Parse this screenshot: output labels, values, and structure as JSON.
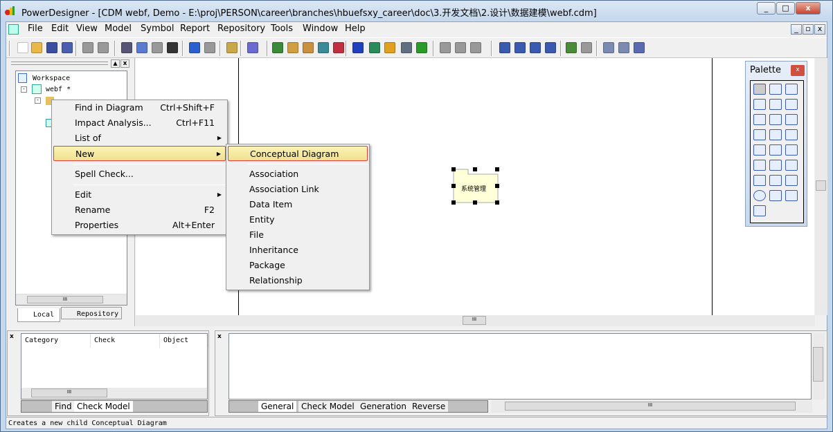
{
  "window": {
    "title": "PowerDesigner - [CDM webf, Demo - E:\\proj\\PERSON\\career\\branches\\hbuefsxy_career\\doc\\3.开发文档\\2.设计\\数据建模\\webf.cdm]",
    "buttons": [
      "_",
      "□",
      "x"
    ],
    "mdi_buttons": [
      "_",
      "▫",
      "x"
    ]
  },
  "menubar": [
    "File",
    "Edit",
    "View",
    "Model",
    "Symbol",
    "Report",
    "Repository",
    "Tools",
    "Window",
    "Help"
  ],
  "toolbar": {
    "icons": [
      "new-icon",
      "open-icon",
      "save-icon",
      "save-all-icon",
      "print-preview-icon",
      "print-icon",
      "cut-icon",
      "copy-icon",
      "paste-icon",
      "delete-icon",
      "undo-icon",
      "redo-icon",
      "properties-icon",
      "help-icon",
      "new-model-icon",
      "check-model-icon",
      "find-icon",
      "refresh-icon",
      "check-icon",
      "shadow-icon",
      "text-icon",
      "paint-icon",
      "fill-icon",
      "font-icon",
      "object-icon",
      "back-icon",
      "forward-icon",
      "diagram1-icon",
      "diagram2-icon",
      "page-icon",
      "pages-icon",
      "generate-icon",
      "disabled-icon",
      "browser-icon",
      "output-icon",
      "result-list-icon"
    ]
  },
  "browser": {
    "tree": {
      "root": "Workspace",
      "model": "webf *"
    },
    "tabs": [
      "Local",
      "Repository"
    ]
  },
  "context_menu": {
    "items": [
      {
        "label": "Find in Diagram",
        "shortcut": "Ctrl+Shift+F"
      },
      {
        "label": "Impact Analysis...",
        "shortcut": "Ctrl+F11"
      },
      {
        "label": "List of",
        "submenu": true
      },
      {
        "label": "New",
        "submenu": true,
        "highlighted": true
      },
      {
        "label": "Spell Check..."
      },
      {
        "label": "Edit",
        "submenu": true
      },
      {
        "label": "Rename",
        "shortcut": "F2"
      },
      {
        "label": "Properties",
        "shortcut": "Alt+Enter"
      }
    ]
  },
  "submenu": {
    "items": [
      "Conceptual Diagram",
      "Association",
      "Association Link",
      "Data Item",
      "Entity",
      "File",
      "Inheritance",
      "Package",
      "Relationship"
    ],
    "highlighted": "Conceptual Diagram"
  },
  "canvas": {
    "package_symbol": "系统管理"
  },
  "palette": {
    "title": "Palette",
    "tools": [
      "pointer-icon",
      "hand-icon",
      "zoom-in-icon",
      "zoom-out-icon",
      "zoom-fit-icon",
      "properties-icon",
      "delete-icon",
      "package-icon",
      "entity-icon",
      "relationship-icon",
      "inheritance-icon",
      "association-icon",
      "association-link-icon",
      "file-icon",
      "note-icon",
      "link-icon",
      "data-item-icon",
      "text-icon",
      "line-icon",
      "arc-icon",
      "rectangle-icon",
      "ellipse-icon",
      "rounded-rect-icon",
      "polyline-icon",
      "polygon-icon"
    ]
  },
  "result_list": {
    "columns": [
      "Category",
      "Check",
      "Object"
    ],
    "tabs": [
      "Find",
      "Check Model"
    ],
    "active_tab": "Check Model"
  },
  "output": {
    "tabs": [
      "General",
      "Check Model",
      "Generation",
      "Reverse"
    ],
    "active_tab": "General"
  },
  "status_bar": "Creates a new child Conceptual Diagram",
  "colors": {
    "highlight_border": "#e43b3b",
    "highlight_fill": "#f7eaa0",
    "package_fill": "#ffffd8"
  }
}
